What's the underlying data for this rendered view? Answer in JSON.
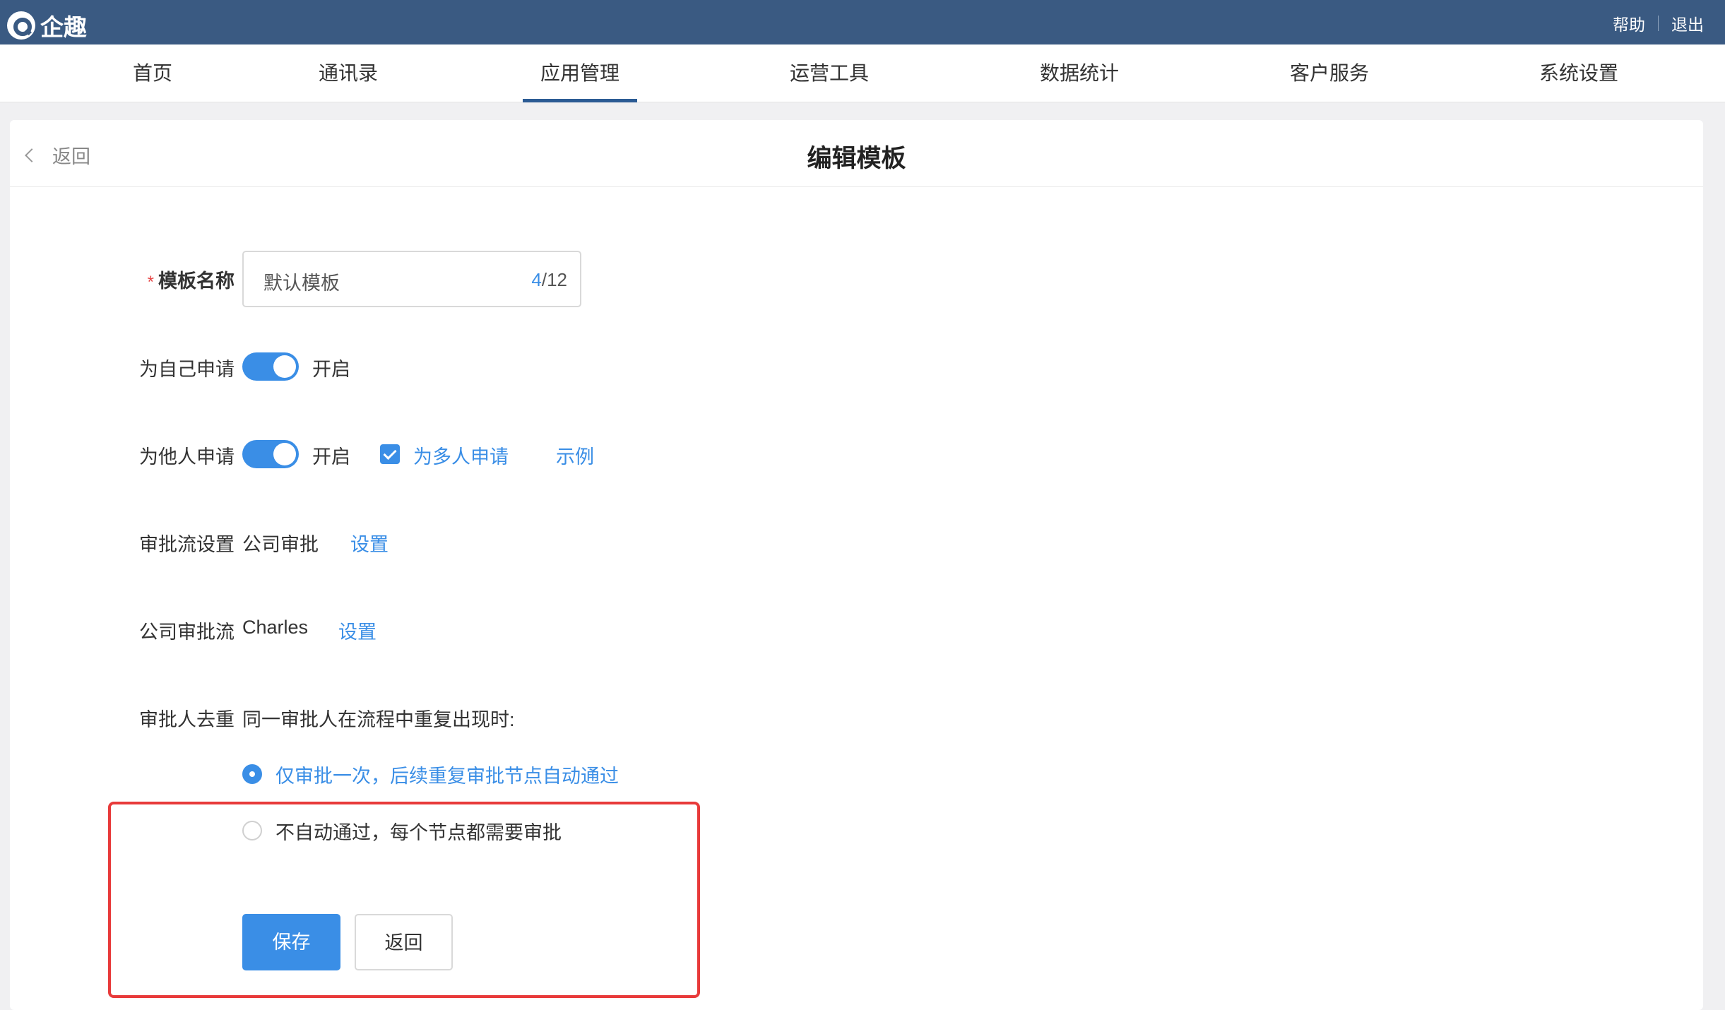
{
  "app": {
    "name": "企趣"
  },
  "topbar": {
    "help": "帮助",
    "logout": "退出"
  },
  "nav": {
    "items": [
      "首页",
      "通讯录",
      "应用管理",
      "运营工具",
      "数据统计",
      "客户服务",
      "系统设置"
    ],
    "active": "应用管理"
  },
  "header": {
    "back": "返回",
    "title": "编辑模板"
  },
  "form": {
    "template_name": {
      "label": "模板名称",
      "required_mark": "*",
      "value": "默认模板",
      "count_current": "4",
      "count_max": "/12"
    },
    "self_apply": {
      "label": "为自己申请",
      "state": "开启",
      "enabled": true
    },
    "other_apply": {
      "label": "为他人申请",
      "state": "开启",
      "enabled": true,
      "multi_label": "为多人申请",
      "multi_checked": true,
      "example": "示例"
    },
    "flow_setting": {
      "label": "审批流设置",
      "value": "公司审批",
      "action": "设置"
    },
    "company_flow": {
      "label": "公司审批流",
      "value": "Charles",
      "action": "设置"
    },
    "dedupe": {
      "label": "审批人去重",
      "description": "同一审批人在流程中重复出现时:",
      "options": [
        {
          "label": "仅审批一次，后续重复审批节点自动通过",
          "checked": true
        },
        {
          "label": "不自动通过，每个节点都需要审批",
          "checked": false
        }
      ]
    }
  },
  "buttons": {
    "save": "保存",
    "back": "返回"
  },
  "colors": {
    "topbar": "#3a5a82",
    "accent": "#3a8ee6",
    "highlight": "#e83a3a"
  }
}
